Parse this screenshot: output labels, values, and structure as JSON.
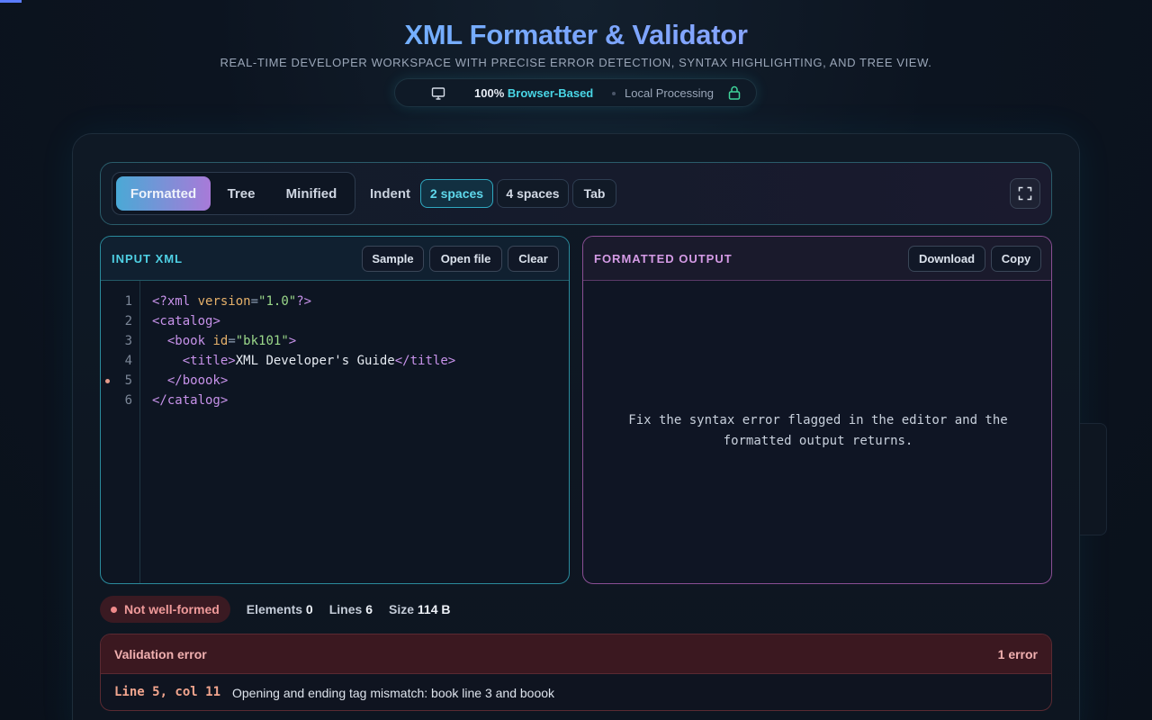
{
  "header": {
    "title": "XML Formatter & Validator",
    "subtitle": "REAL-TIME DEVELOPER WORKSPACE WITH PRECISE ERROR DETECTION, SYNTAX HIGHLIGHTING, AND TREE VIEW.",
    "badge": {
      "icon": "monitor-icon",
      "browser_prefix": "100%",
      "browser_text": "Browser-Based",
      "local_text": "Local Processing",
      "lock_icon": "lock-icon"
    }
  },
  "toolbar": {
    "views": [
      "Formatted",
      "Tree",
      "Minified"
    ],
    "active_view": "Formatted",
    "indent_label": "Indent",
    "indents": [
      "2 spaces",
      "4 spaces",
      "Tab"
    ],
    "active_indent": "2 spaces",
    "fullscreen_icon": "expand-icon"
  },
  "input_panel": {
    "title": "INPUT XML",
    "buttons": [
      "Sample",
      "Open file",
      "Clear"
    ],
    "line_numbers": [
      "1",
      "2",
      "3",
      "4",
      "5",
      "6"
    ],
    "error_line": 5,
    "code_lines": [
      "<?xml version=\"1.0\"?>",
      "<catalog>",
      "  <book id=\"bk101\">",
      "    <title>XML Developer's Guide</title>",
      "  </boook>",
      "</catalog>"
    ]
  },
  "output_panel": {
    "title": "FORMATTED OUTPUT",
    "buttons": [
      "Download",
      "Copy"
    ],
    "message_line1": "Fix the syntax error flagged in the editor and the",
    "message_line2": "formatted output returns."
  },
  "status": {
    "state": "Not well-formed",
    "elements_label": "Elements",
    "elements_value": "0",
    "lines_label": "Lines",
    "lines_value": "6",
    "size_label": "Size",
    "size_value": "114 B"
  },
  "validation": {
    "title": "Validation error",
    "count": "1 error",
    "location": "Line 5, col 11",
    "message": "Opening and ending tag mismatch: book line 3 and boook"
  },
  "colors": {
    "tag": "#c792ea",
    "attribute": "#e5b06a",
    "string": "#9bd88a",
    "text": "#e6ebf2",
    "accent_cyan": "#49d6e6",
    "error": "#ef9a9a"
  }
}
